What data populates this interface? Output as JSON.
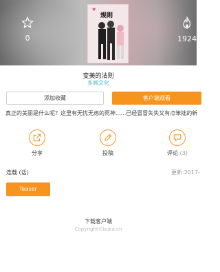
{
  "header": {
    "favorites_count": "0",
    "popularity_count": "1924",
    "star_icon": "star-icon",
    "flame_icon": "flame-icon",
    "cover_logo": "规则"
  },
  "comic": {
    "title": "变美的法则",
    "publisher": "多闻文化"
  },
  "buttons": {
    "add_favorite": "添加收藏",
    "read_in_app": "客户端观看"
  },
  "description": "真正的美丽是什么呢？这里有无忧无虑的死神......已经冒冒失失又有点笨拙的新",
  "actions": [
    {
      "label": "分享",
      "icon": "share-icon"
    },
    {
      "label": "投稿",
      "icon": "submit-icon"
    },
    {
      "label": "评论",
      "count": "(3)",
      "icon": "comment-icon"
    }
  ],
  "chapters": {
    "serial_label": "连载 (话)",
    "updated_label": "更新:2017-",
    "items": [
      "Teaser"
    ]
  },
  "footer": {
    "download": "下载客户端",
    "copyright": "Copyright©buka.cn"
  },
  "colors": {
    "accent": "#f7941d",
    "publisher": "#48b7c8"
  }
}
